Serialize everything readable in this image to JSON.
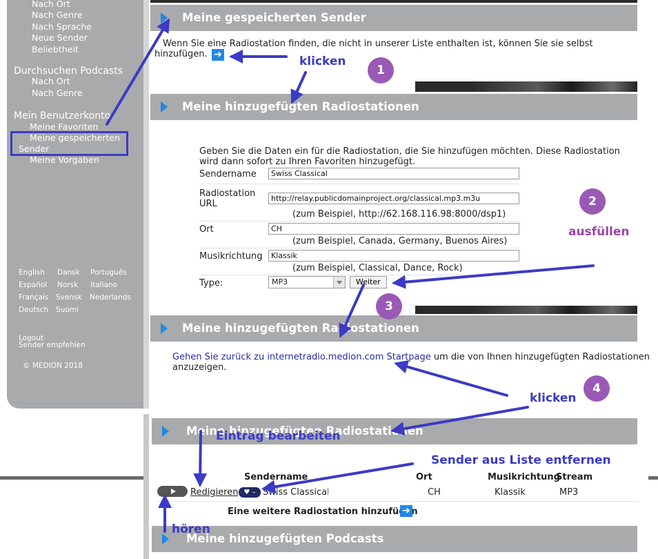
{
  "sidebar": {
    "nav_top": [
      "Nach Ort",
      "Nach Genre",
      "Nach Sprache",
      "Neue Sender",
      "Beliebtheit"
    ],
    "podcasts_heading": "Durchsuchen Podcasts",
    "podcasts_items": [
      "Nach Ort",
      "Nach Genre"
    ],
    "account_heading": "Mein Benutzerkonto",
    "account_items": [
      "Meine Favoriten",
      "Meine gespeicherten",
      "Sender",
      "Meine Vorgaben"
    ],
    "languages": [
      "English",
      "Dansk",
      "Português",
      "Español",
      "Norsk",
      "Italiano",
      "Français",
      "Svensk",
      "Nederlands",
      "Deutsch",
      "Suomi"
    ],
    "logout": "Logout",
    "recommend": "Sender empfehlen",
    "copyright": "© MEDION 2018"
  },
  "section1": {
    "title": "Meine gespeicherten Sender",
    "text_line1": "Wenn Sie eine Radiostation finden, die nicht in unserer Liste enthalten ist, können Sie sie selbst",
    "text_line2": "hinzufügen.",
    "arrow_glyph": "➔"
  },
  "section2": {
    "title": "Meine hinzugefügten Radiostationen",
    "intro_line1": "Geben Sie die Daten ein für die Radiostation, die Sie hinzufügen möchten. Diese Radiostation",
    "intro_line2": "wird dann sofort zu Ihren Favoriten hinzugefügt.",
    "fields": {
      "sendername_label": "Sendername",
      "sendername_value": "Swiss Classical",
      "url_label_line1": "Radiostation",
      "url_label_line2": "URL",
      "url_value": "http://relay.publicdomainproject.org/classical.mp3.m3u",
      "url_hint": "(zum Beispiel, http://62.168.116.98:8000/dsp1)",
      "ort_label": "Ort",
      "ort_value": "CH",
      "ort_hint": "(zum Beispiel, Canada, Germany, Buenos Aires)",
      "genre_label": "Musikrichtung",
      "genre_value": "Klassik",
      "genre_hint": "(zum Beispiel, Classical, Dance, Rock)",
      "type_label": "Type:",
      "type_value": "MP3",
      "weiter_label": "Weiter"
    }
  },
  "section3": {
    "title": "Meine hinzugefügten Radiostationen",
    "link_part1": "Gehen Sie zurück zu internetradio.medion.com Startpage",
    "text_part2": " um die von Ihnen hinzugefügten Radiostationen",
    "text_line2": "anzuzeigen."
  },
  "section4": {
    "title": "Meine hinzugefügten Radiostationen",
    "columns": [
      "Sendername",
      "Ort",
      "Musikrichtung",
      "Stream"
    ],
    "row": {
      "edit_label": "Redigieren",
      "fav_glyph": "♥ –",
      "name": "Swiss Classical",
      "ort": "CH",
      "genre": "Klassik",
      "stream": "MP3"
    },
    "add_label": "Eine weitere Radiostation hinzufügen"
  },
  "section5": {
    "title": "Meine hinzugefügten Podcasts"
  },
  "annotations": {
    "click1": "klicken",
    "fill": "ausfüllen",
    "click2": "klicken",
    "edit": "Eintrag bearbeiten",
    "remove": "Sender aus Liste entfernen",
    "listen": "hören",
    "steps": [
      "1",
      "2",
      "3",
      "4"
    ]
  }
}
